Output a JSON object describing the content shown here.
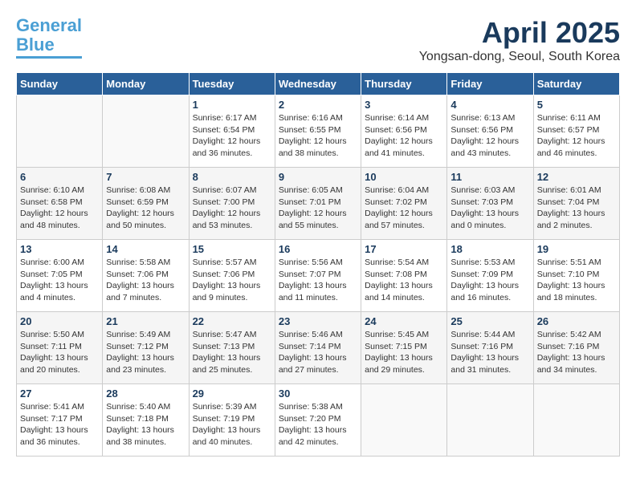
{
  "header": {
    "logo_line1": "General",
    "logo_line2": "Blue",
    "month_title": "April 2025",
    "location": "Yongsan-dong, Seoul, South Korea"
  },
  "weekdays": [
    "Sunday",
    "Monday",
    "Tuesday",
    "Wednesday",
    "Thursday",
    "Friday",
    "Saturday"
  ],
  "weeks": [
    [
      null,
      null,
      {
        "day": "1",
        "sunrise": "6:17 AM",
        "sunset": "6:54 PM",
        "daylight": "12 hours and 36 minutes."
      },
      {
        "day": "2",
        "sunrise": "6:16 AM",
        "sunset": "6:55 PM",
        "daylight": "12 hours and 38 minutes."
      },
      {
        "day": "3",
        "sunrise": "6:14 AM",
        "sunset": "6:56 PM",
        "daylight": "12 hours and 41 minutes."
      },
      {
        "day": "4",
        "sunrise": "6:13 AM",
        "sunset": "6:56 PM",
        "daylight": "12 hours and 43 minutes."
      },
      {
        "day": "5",
        "sunrise": "6:11 AM",
        "sunset": "6:57 PM",
        "daylight": "12 hours and 46 minutes."
      }
    ],
    [
      {
        "day": "6",
        "sunrise": "6:10 AM",
        "sunset": "6:58 PM",
        "daylight": "12 hours and 48 minutes."
      },
      {
        "day": "7",
        "sunrise": "6:08 AM",
        "sunset": "6:59 PM",
        "daylight": "12 hours and 50 minutes."
      },
      {
        "day": "8",
        "sunrise": "6:07 AM",
        "sunset": "7:00 PM",
        "daylight": "12 hours and 53 minutes."
      },
      {
        "day": "9",
        "sunrise": "6:05 AM",
        "sunset": "7:01 PM",
        "daylight": "12 hours and 55 minutes."
      },
      {
        "day": "10",
        "sunrise": "6:04 AM",
        "sunset": "7:02 PM",
        "daylight": "12 hours and 57 minutes."
      },
      {
        "day": "11",
        "sunrise": "6:03 AM",
        "sunset": "7:03 PM",
        "daylight": "13 hours and 0 minutes."
      },
      {
        "day": "12",
        "sunrise": "6:01 AM",
        "sunset": "7:04 PM",
        "daylight": "13 hours and 2 minutes."
      }
    ],
    [
      {
        "day": "13",
        "sunrise": "6:00 AM",
        "sunset": "7:05 PM",
        "daylight": "13 hours and 4 minutes."
      },
      {
        "day": "14",
        "sunrise": "5:58 AM",
        "sunset": "7:06 PM",
        "daylight": "13 hours and 7 minutes."
      },
      {
        "day": "15",
        "sunrise": "5:57 AM",
        "sunset": "7:06 PM",
        "daylight": "13 hours and 9 minutes."
      },
      {
        "day": "16",
        "sunrise": "5:56 AM",
        "sunset": "7:07 PM",
        "daylight": "13 hours and 11 minutes."
      },
      {
        "day": "17",
        "sunrise": "5:54 AM",
        "sunset": "7:08 PM",
        "daylight": "13 hours and 14 minutes."
      },
      {
        "day": "18",
        "sunrise": "5:53 AM",
        "sunset": "7:09 PM",
        "daylight": "13 hours and 16 minutes."
      },
      {
        "day": "19",
        "sunrise": "5:51 AM",
        "sunset": "7:10 PM",
        "daylight": "13 hours and 18 minutes."
      }
    ],
    [
      {
        "day": "20",
        "sunrise": "5:50 AM",
        "sunset": "7:11 PM",
        "daylight": "13 hours and 20 minutes."
      },
      {
        "day": "21",
        "sunrise": "5:49 AM",
        "sunset": "7:12 PM",
        "daylight": "13 hours and 23 minutes."
      },
      {
        "day": "22",
        "sunrise": "5:47 AM",
        "sunset": "7:13 PM",
        "daylight": "13 hours and 25 minutes."
      },
      {
        "day": "23",
        "sunrise": "5:46 AM",
        "sunset": "7:14 PM",
        "daylight": "13 hours and 27 minutes."
      },
      {
        "day": "24",
        "sunrise": "5:45 AM",
        "sunset": "7:15 PM",
        "daylight": "13 hours and 29 minutes."
      },
      {
        "day": "25",
        "sunrise": "5:44 AM",
        "sunset": "7:16 PM",
        "daylight": "13 hours and 31 minutes."
      },
      {
        "day": "26",
        "sunrise": "5:42 AM",
        "sunset": "7:16 PM",
        "daylight": "13 hours and 34 minutes."
      }
    ],
    [
      {
        "day": "27",
        "sunrise": "5:41 AM",
        "sunset": "7:17 PM",
        "daylight": "13 hours and 36 minutes."
      },
      {
        "day": "28",
        "sunrise": "5:40 AM",
        "sunset": "7:18 PM",
        "daylight": "13 hours and 38 minutes."
      },
      {
        "day": "29",
        "sunrise": "5:39 AM",
        "sunset": "7:19 PM",
        "daylight": "13 hours and 40 minutes."
      },
      {
        "day": "30",
        "sunrise": "5:38 AM",
        "sunset": "7:20 PM",
        "daylight": "13 hours and 42 minutes."
      },
      null,
      null,
      null
    ]
  ],
  "labels": {
    "sunrise_prefix": "Sunrise: ",
    "sunset_prefix": "Sunset: ",
    "daylight_prefix": "Daylight: "
  }
}
